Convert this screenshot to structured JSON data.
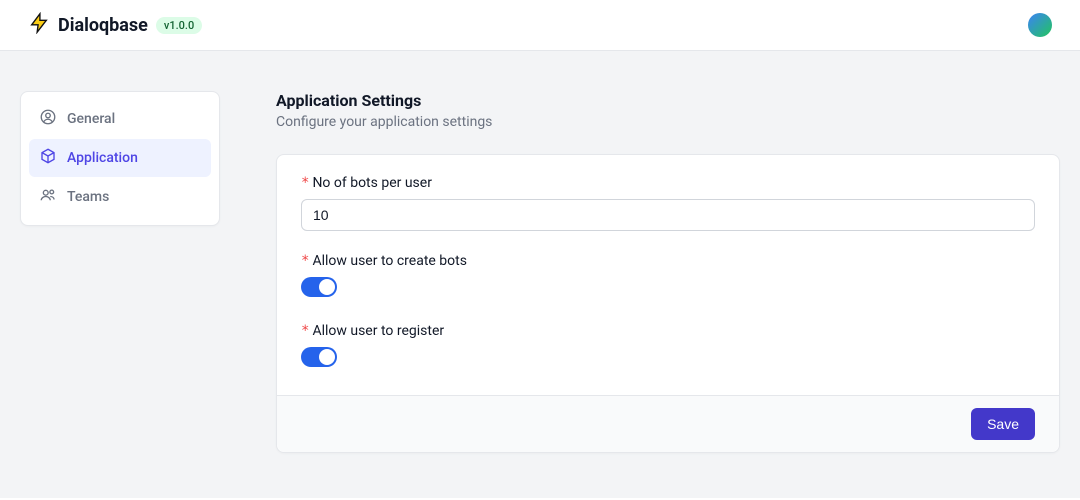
{
  "header": {
    "app_name": "Dialoqbase",
    "version": "v1.0.0"
  },
  "sidebar": {
    "items": [
      {
        "label": "General",
        "icon": "user-circle-icon",
        "active": false
      },
      {
        "label": "Application",
        "icon": "cube-icon",
        "active": true
      },
      {
        "label": "Teams",
        "icon": "users-icon",
        "active": false
      }
    ]
  },
  "page": {
    "title": "Application Settings",
    "subtitle": "Configure your application settings"
  },
  "form": {
    "no_of_bots_label": "No of bots per user",
    "no_of_bots_value": "10",
    "allow_create_bots_label": "Allow user to create bots",
    "allow_create_bots_value": true,
    "allow_register_label": "Allow user to register",
    "allow_register_value": true,
    "save_label": "Save"
  }
}
